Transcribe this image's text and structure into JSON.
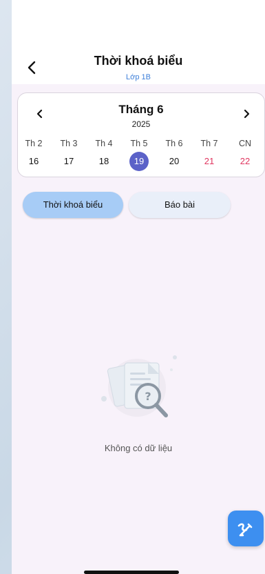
{
  "header": {
    "title": "Thời khoá biểu",
    "subtitle": "Lớp 1B"
  },
  "calendar": {
    "month": "Tháng 6",
    "year": "2025",
    "days": [
      {
        "name": "Th 2",
        "date": "16"
      },
      {
        "name": "Th 3",
        "date": "17"
      },
      {
        "name": "Th 4",
        "date": "18"
      },
      {
        "name": "Th 5",
        "date": "19"
      },
      {
        "name": "Th 6",
        "date": "20"
      },
      {
        "name": "Th 7",
        "date": "21"
      },
      {
        "name": "CN",
        "date": "22"
      }
    ],
    "selected_date": "19"
  },
  "tabs": [
    {
      "label": "Thời khoá biểu"
    },
    {
      "label": "Báo bài"
    }
  ],
  "empty_state": {
    "text": "Không có dữ liệu",
    "icon": "document-search-icon"
  },
  "fab": {
    "icon": "edit-pencil-icon"
  },
  "colors": {
    "selected_day": "#5b62c8",
    "weekend": "#e0355f",
    "active_tab": "#a7ccf6",
    "fab": "#3d8ff0",
    "subtitle": "#3d7fd9"
  }
}
